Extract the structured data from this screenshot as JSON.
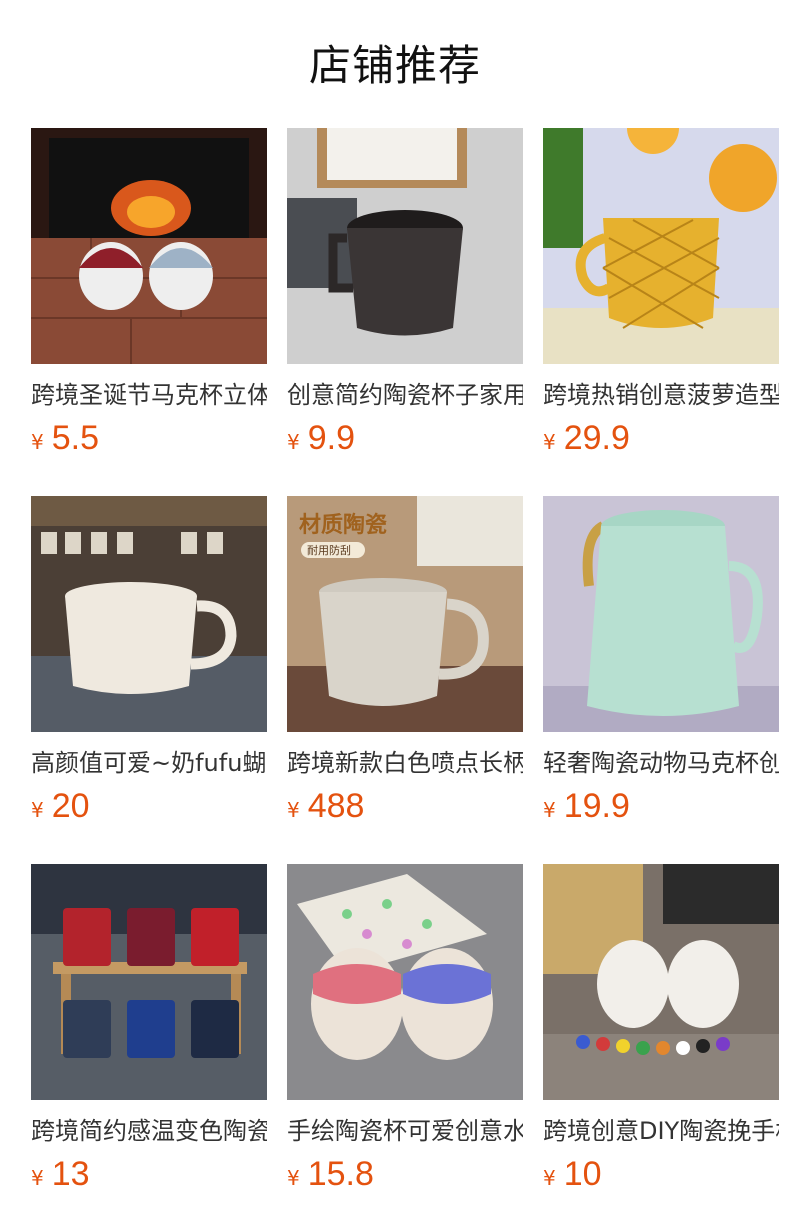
{
  "page": {
    "title": "店铺推荐",
    "currency_symbol": "¥",
    "accent_color": "#e4520f"
  },
  "products": [
    {
      "name": "跨境圣诞节马克杯立体陶瓷杯",
      "price": "5.5",
      "image": "christmas-gnome-mugs-by-fireplace"
    },
    {
      "name": "创意简约陶瓷杯子家用水杯",
      "price": "9.9",
      "image": "dark-geometric-ceramic-mug"
    },
    {
      "name": "跨境热销创意菠萝造型陶瓷杯",
      "price": "29.9",
      "image": "yellow-pineapple-mug"
    },
    {
      "name": "高颜值可爱~奶fufu蝴蝶结陶瓷杯",
      "price": "20",
      "image": "white-embossed-cup-in-cafe"
    },
    {
      "name": "跨境新款白色喷点长柄陶瓷杯",
      "price": "488",
      "image": "speckled-white-mug-with-badge"
    },
    {
      "name": "轻奢陶瓷动物马克杯创意水杯",
      "price": "19.9",
      "image": "mint-green-animal-mug"
    },
    {
      "name": "跨境简约感温变色陶瓷杯",
      "price": "13",
      "image": "football-club-color-change-mugs"
    },
    {
      "name": "手绘陶瓷杯可爱创意水杯",
      "price": "15.8",
      "image": "dripping-glaze-hand-painted-mugs"
    },
    {
      "name": "跨境创意DIY陶瓷挽手杯",
      "price": "10",
      "image": "diy-figure-mugs-with-paints"
    }
  ],
  "badges": {
    "card5_overlay_title": "材质陶瓷",
    "card5_overlay_tag": "耐用防刮"
  }
}
